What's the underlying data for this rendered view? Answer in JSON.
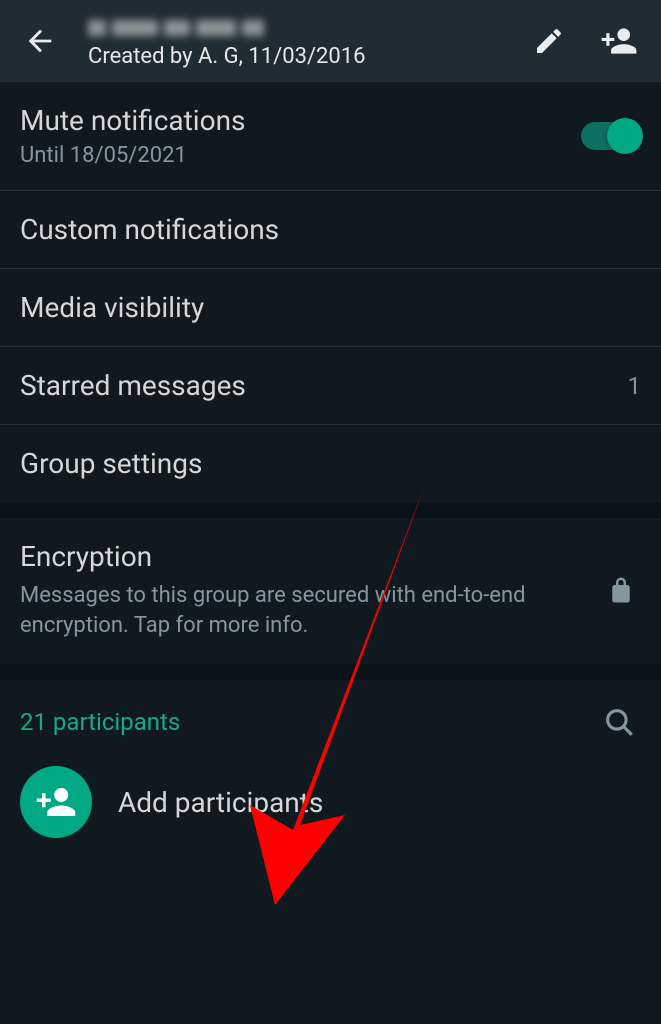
{
  "header": {
    "subtitle": "Created by A. G, 11/03/2016"
  },
  "settings": {
    "mute": {
      "title": "Mute notifications",
      "sub": "Until 18/05/2021",
      "enabled": true
    },
    "custom": {
      "title": "Custom notifications"
    },
    "media": {
      "title": "Media visibility"
    },
    "starred": {
      "title": "Starred messages",
      "count": "1"
    },
    "group": {
      "title": "Group settings"
    }
  },
  "encryption": {
    "title": "Encryption",
    "desc": "Messages to this group are secured with end-to-end encryption. Tap for more info."
  },
  "participants": {
    "count_label": "21 participants",
    "add_label": "Add participants"
  },
  "colors": {
    "accent": "#00a884"
  }
}
